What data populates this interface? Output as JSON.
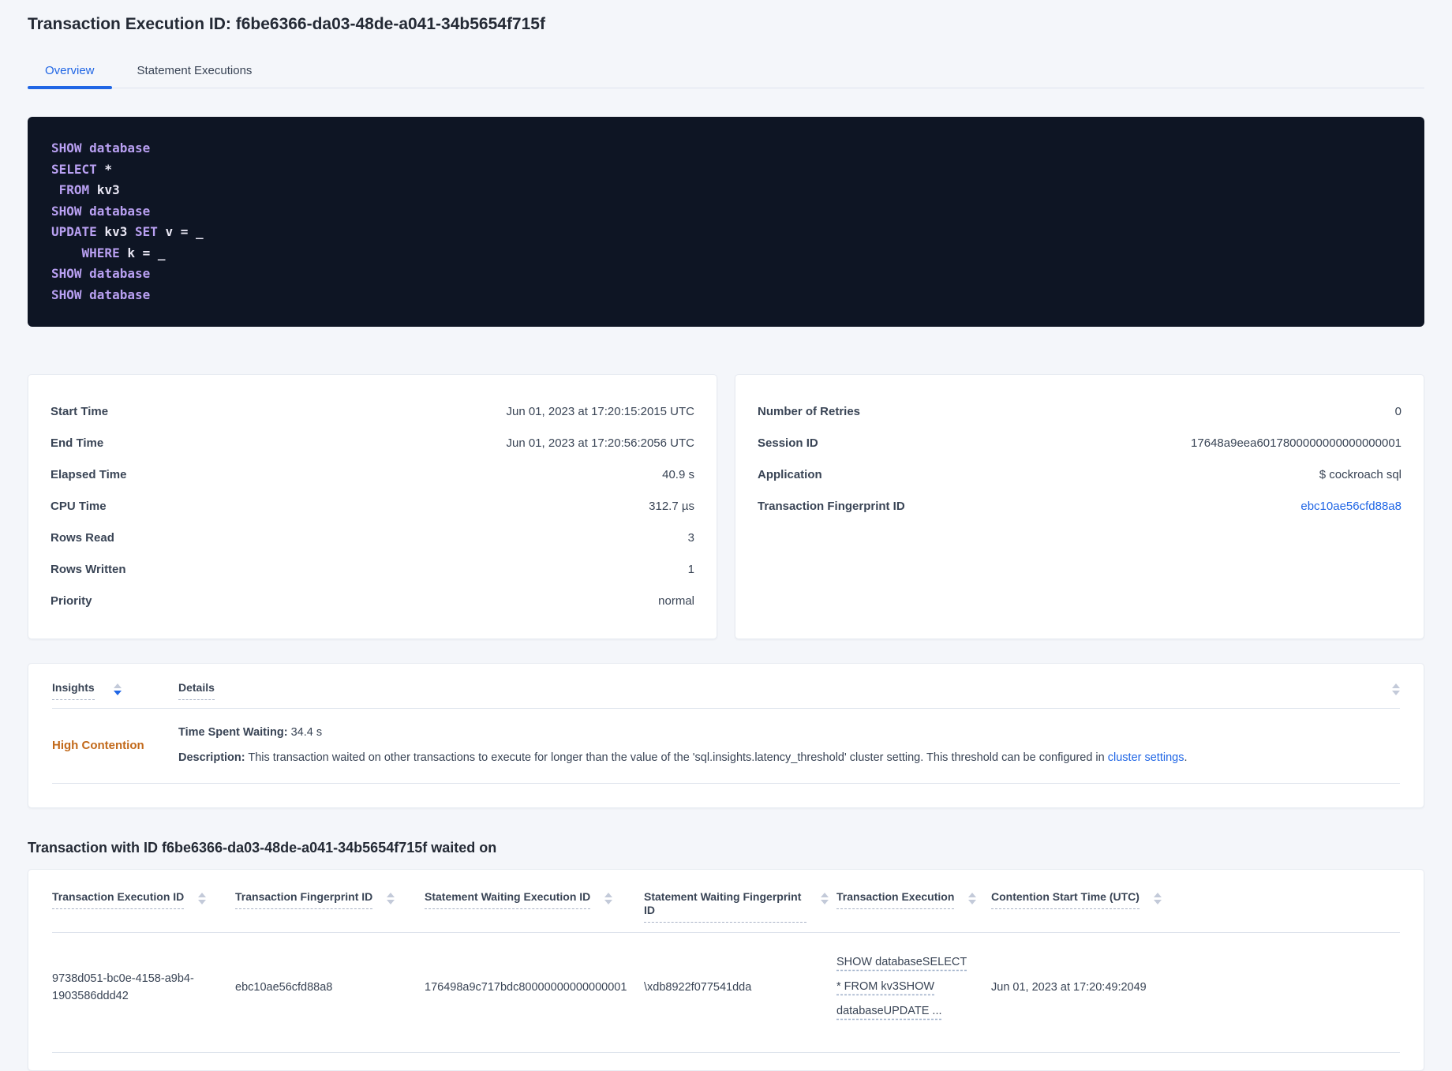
{
  "page": {
    "title": "Transaction Execution ID: f6be6366-da03-48de-a041-34b5654f715f"
  },
  "tabs": [
    {
      "label": "Overview",
      "active": true
    },
    {
      "label": "Statement Executions",
      "active": false
    }
  ],
  "colors": {
    "accent_blue": "#2066e5",
    "insight_orange": "#c2691a",
    "code_background": "#0e1524",
    "sql_keyword_purple": "#b9a0f2",
    "page_background": "#f4f6fa"
  },
  "sql": {
    "lines": [
      {
        "tokens": [
          {
            "t": "SHOW database",
            "c": "k"
          }
        ]
      },
      {
        "tokens": [
          {
            "t": "SELECT",
            "c": "k"
          },
          {
            "t": " *",
            "c": "p"
          }
        ]
      },
      {
        "tokens": [
          {
            "t": " FROM",
            "c": "k"
          },
          {
            "t": " kv3",
            "c": "p"
          }
        ]
      },
      {
        "tokens": [
          {
            "t": "SHOW database",
            "c": "k"
          }
        ]
      },
      {
        "tokens": [
          {
            "t": "UPDATE",
            "c": "k"
          },
          {
            "t": " kv3 ",
            "c": "p"
          },
          {
            "t": "SET",
            "c": "k"
          },
          {
            "t": " v = _",
            "c": "p"
          }
        ]
      },
      {
        "tokens": [
          {
            "t": "    WHERE",
            "c": "k"
          },
          {
            "t": " k = _",
            "c": "p"
          }
        ]
      },
      {
        "tokens": [
          {
            "t": "SHOW database",
            "c": "k"
          }
        ]
      },
      {
        "tokens": [
          {
            "t": "SHOW database",
            "c": "k"
          }
        ]
      }
    ]
  },
  "cards": {
    "execution": {
      "rows": [
        {
          "label": "Start Time",
          "value": "Jun 01, 2023 at 17:20:15:2015 UTC"
        },
        {
          "label": "End Time",
          "value": "Jun 01, 2023 at 17:20:56:2056 UTC"
        },
        {
          "label": "Elapsed Time",
          "value": "40.9 s"
        },
        {
          "label": "CPU Time",
          "value": "312.7 µs"
        },
        {
          "label": "Rows Read",
          "value": "3"
        },
        {
          "label": "Rows Written",
          "value": "1"
        },
        {
          "label": "Priority",
          "value": "normal"
        }
      ]
    },
    "session": {
      "rows": [
        {
          "label": "Number of Retries",
          "value": "0"
        },
        {
          "label": "Session ID",
          "value": "17648a9eea6017800000000000000001"
        },
        {
          "label": "Application",
          "value": "$ cockroach sql"
        },
        {
          "label": "Transaction Fingerprint ID",
          "value": "ebc10ae56cfd88a8",
          "link": true
        }
      ]
    }
  },
  "insights": {
    "headers": {
      "insights": "Insights",
      "details": "Details"
    },
    "row": {
      "insight": "High Contention",
      "waiting_label": "Time Spent Waiting:",
      "waiting_value": "34.4 s",
      "description_label": "Description:",
      "description_text": "This transaction waited on other transactions to execute for longer than the value of the 'sql.insights.latency_threshold' cluster setting. This threshold can be configured in ",
      "description_link": "cluster settings",
      "description_suffix": "."
    }
  },
  "waited": {
    "heading": "Transaction with ID f6be6366-da03-48de-a041-34b5654f715f waited on",
    "columns": [
      "Transaction Execution ID",
      "Transaction Fingerprint ID",
      "Statement Waiting Execution ID",
      "Statement Waiting Fingerprint ID",
      "Transaction Execution",
      "Contention Start Time (UTC)"
    ],
    "row": {
      "transaction_execution_id": "9738d051-bc0e-4158-a9b4-1903586ddd42",
      "transaction_fingerprint_id": "ebc10ae56cfd88a8",
      "statement_waiting_execution_id": "176498a9c717bdc80000000000000001",
      "statement_waiting_fingerprint_id": "\\xdb8922f077541dda",
      "transaction_execution": "SHOW databaseSELECT * FROM kv3SHOW databaseUPDATE ...",
      "contention_start_time": "Jun 01, 2023 at 17:20:49:2049"
    }
  }
}
